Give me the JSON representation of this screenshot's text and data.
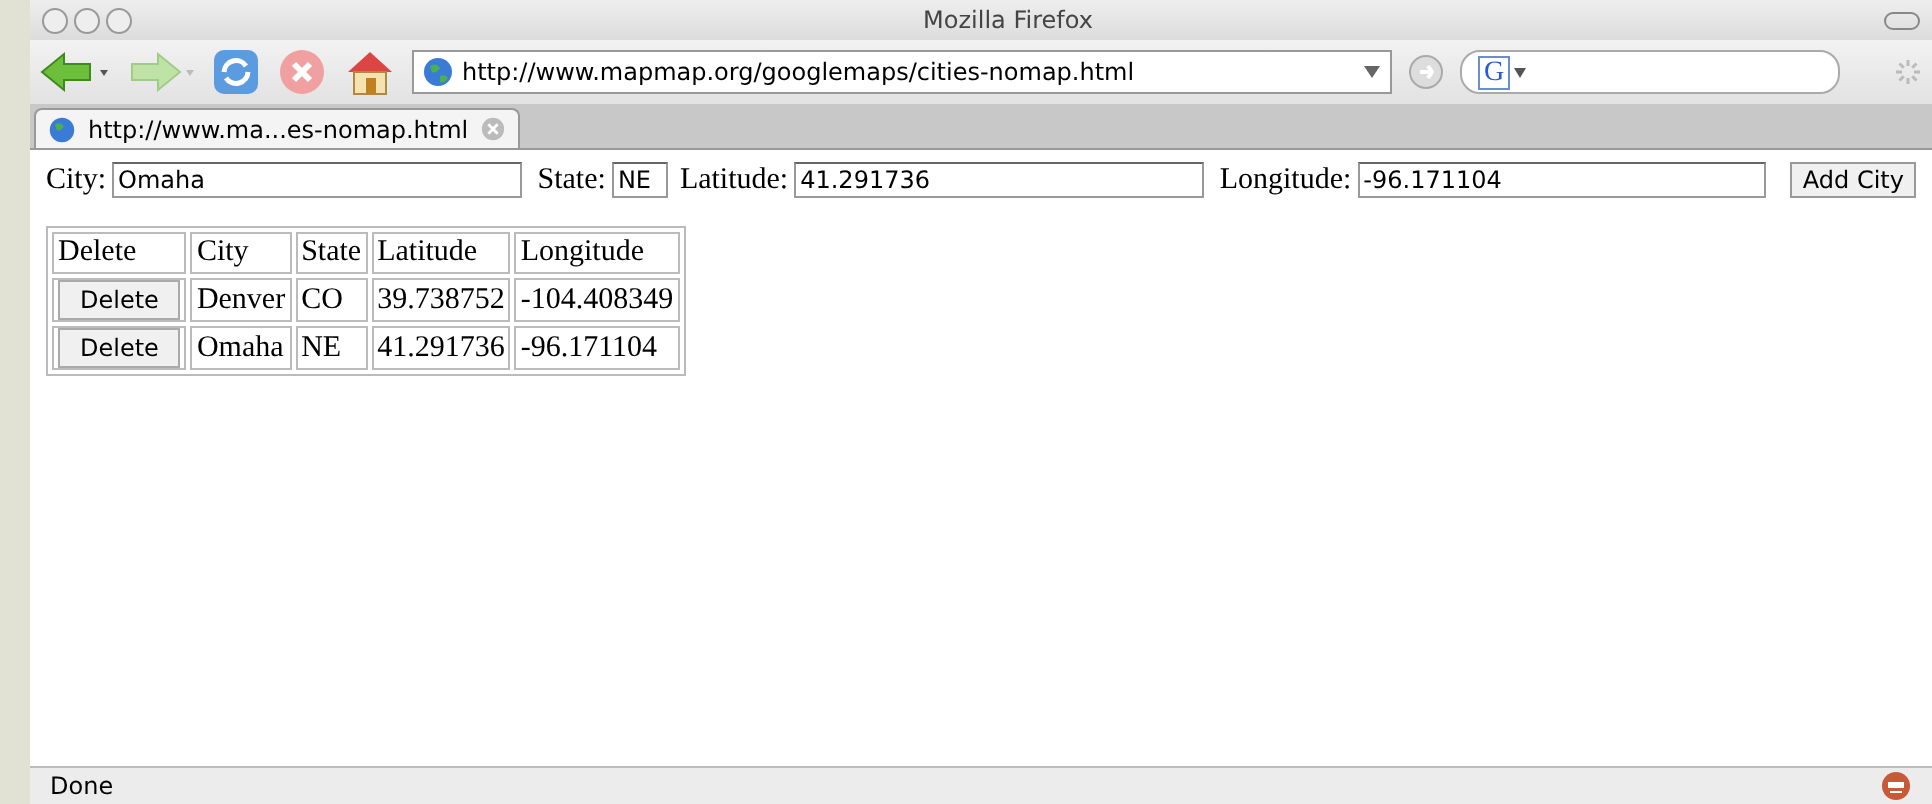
{
  "window": {
    "title": "Mozilla Firefox"
  },
  "toolbar": {
    "url": "http://www.mapmap.org/googlemaps/cities-nomap.html",
    "search_placeholder": "G"
  },
  "tabs": [
    {
      "label": "http://www.ma...es-nomap.html",
      "selected": true
    }
  ],
  "form": {
    "fields": [
      {
        "label": "City:",
        "value": "Omaha",
        "kind": "text"
      },
      {
        "label": "State:",
        "value": "NE",
        "kind": "code"
      },
      {
        "label": "Latitude:",
        "value": "41.291736",
        "kind": "text"
      },
      {
        "label": "Longitude:",
        "value": "-96.171104",
        "kind": "text"
      }
    ],
    "button": "Add City"
  },
  "table": {
    "columns": [
      "Delete",
      "City",
      "State",
      "Latitude",
      "Longitude"
    ],
    "rows": [
      [
        "Delete",
        "Denver",
        "CO",
        "39.738752",
        "-104.408349"
      ],
      [
        "Delete",
        "Omaha",
        "NE",
        "41.291736",
        "-96.171104"
      ]
    ]
  },
  "status_bar": "Done"
}
